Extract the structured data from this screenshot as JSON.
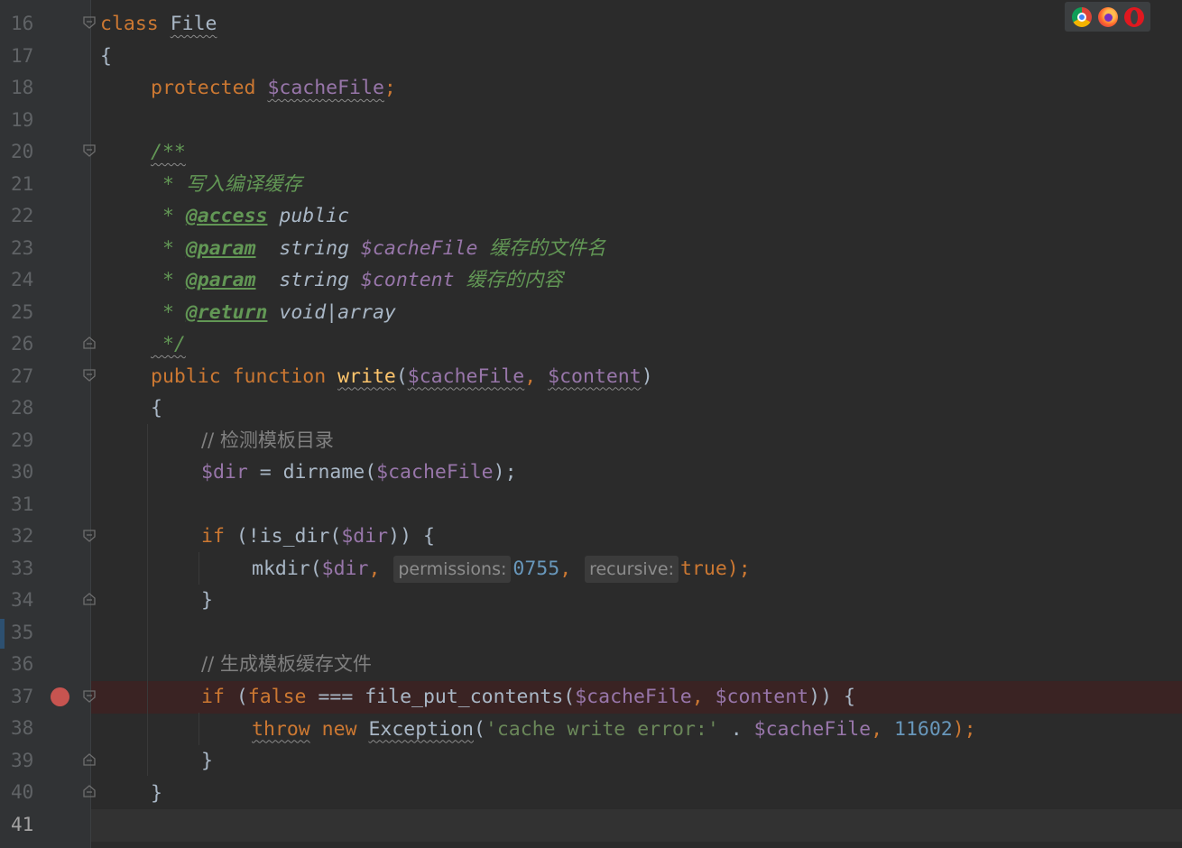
{
  "editor": {
    "lines": [
      {
        "n": "16"
      },
      {
        "n": "17"
      },
      {
        "n": "18"
      },
      {
        "n": "19"
      },
      {
        "n": "20"
      },
      {
        "n": "21"
      },
      {
        "n": "22"
      },
      {
        "n": "23"
      },
      {
        "n": "24"
      },
      {
        "n": "25"
      },
      {
        "n": "26"
      },
      {
        "n": "27"
      },
      {
        "n": "28"
      },
      {
        "n": "29"
      },
      {
        "n": "30"
      },
      {
        "n": "31"
      },
      {
        "n": "32"
      },
      {
        "n": "33"
      },
      {
        "n": "34"
      },
      {
        "n": "35"
      },
      {
        "n": "36"
      },
      {
        "n": "37"
      },
      {
        "n": "38"
      },
      {
        "n": "39"
      },
      {
        "n": "40"
      },
      {
        "n": "41"
      }
    ],
    "code": {
      "l16_kw": "class",
      "l16_name": "File",
      "l17": "{",
      "l18_kw": "protected",
      "l18_var": "$cacheFile",
      "l18_semi": ";",
      "l20": "/**",
      "l21": " * 写入编译缓存",
      "l22_star": " * ",
      "l22_tag": "@access",
      "l22_rest": " public",
      "l23_star": " * ",
      "l23_tag": "@param",
      "l23_type": "  string ",
      "l23_var": "$cacheFile",
      "l23_desc": " 缓存的文件名",
      "l24_star": " * ",
      "l24_tag": "@param",
      "l24_type": "  string ",
      "l24_var": "$content",
      "l24_desc": " 缓存的内容",
      "l25_star": " * ",
      "l25_tag": "@return",
      "l25_rest": " void|array",
      "l26": " */",
      "l27_kw": "public function ",
      "l27_fn": "write",
      "l27_open": "(",
      "l27_v1": "$cacheFile",
      "l27_comma": ", ",
      "l27_v2": "$content",
      "l27_close": ")",
      "l28": "{",
      "l29": "// 检测模板目录",
      "l30_var": "$dir",
      "l30_mid": " = dirname(",
      "l30_var2": "$cacheFile",
      "l30_end": ");",
      "l32_kw": "if",
      "l32_mid": " (!is_dir(",
      "l32_var": "$dir",
      "l32_end": ")) {",
      "l33_fn": "mkdir(",
      "l33_var": "$dir",
      "l33_comma": ", ",
      "l33_hint1": "permissions:",
      "l33_num": "0755",
      "l33_comma2": ", ",
      "l33_hint2": "recursive:",
      "l33_true": "true",
      "l33_end": ");",
      "l34": "}",
      "l36": "// 生成模板缓存文件",
      "l37_kw": "if",
      "l37_open": " (",
      "l37_false": "false",
      "l37_mid": " === file_put_contents(",
      "l37_v1": "$cacheFile",
      "l37_comma": ", ",
      "l37_v2": "$content",
      "l37_end": ")) {",
      "l38_throw": "throw",
      "l38_new": " new ",
      "l38_cls": "Exception",
      "l38_open": "(",
      "l38_str": "'cache write error:'",
      "l38_dot": " . ",
      "l38_var": "$cacheFile",
      "l38_comma": ", ",
      "l38_num": "11602",
      "l38_end": ");",
      "l39": "}",
      "l40": "}"
    }
  },
  "browser_icons": [
    "chrome-icon",
    "firefox-icon",
    "opera-icon"
  ],
  "colors": {
    "background": "#2b2b2b",
    "keyword": "#cc7832",
    "variable": "#9876aa",
    "function": "#ffc66d",
    "number": "#6897bb",
    "string": "#6a8759",
    "comment": "#808080",
    "doc": "#629755",
    "breakpoint": "#c75450"
  }
}
